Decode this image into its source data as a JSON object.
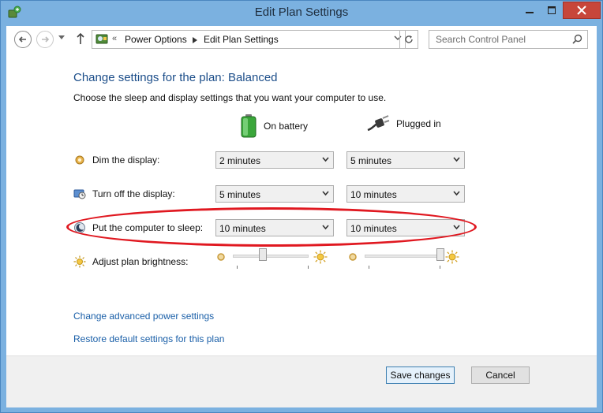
{
  "window": {
    "title": "Edit Plan Settings"
  },
  "nav": {
    "breadcrumb": [
      "Power Options",
      "Edit Plan Settings"
    ],
    "search_placeholder": "Search Control Panel"
  },
  "page": {
    "heading": "Change settings for the plan: Balanced",
    "subheading": "Choose the sleep and display settings that you want your computer to use.",
    "columns": {
      "battery": "On battery",
      "plugged": "Plugged in"
    },
    "settings": [
      {
        "label": "Dim the display:",
        "battery": "2 minutes",
        "plugged": "5 minutes",
        "icon": "dim-display-icon"
      },
      {
        "label": "Turn off the display:",
        "battery": "5 minutes",
        "plugged": "10 minutes",
        "icon": "display-off-icon"
      },
      {
        "label": "Put the computer to sleep:",
        "battery": "10 minutes",
        "plugged": "10 minutes",
        "icon": "sleep-icon"
      }
    ],
    "brightness": {
      "label": "Adjust plan brightness:",
      "battery_level": 0.4,
      "plugged_level": 1.0
    },
    "links": {
      "advanced": "Change advanced power settings",
      "restore": "Restore default settings for this plan"
    }
  },
  "footer": {
    "save": "Save changes",
    "cancel": "Cancel"
  },
  "colors": {
    "frame": "#7bb1e0",
    "heading": "#1b4d89",
    "link": "#1a5fa8",
    "highlight": "#e01820",
    "close_button": "#c7463a"
  }
}
